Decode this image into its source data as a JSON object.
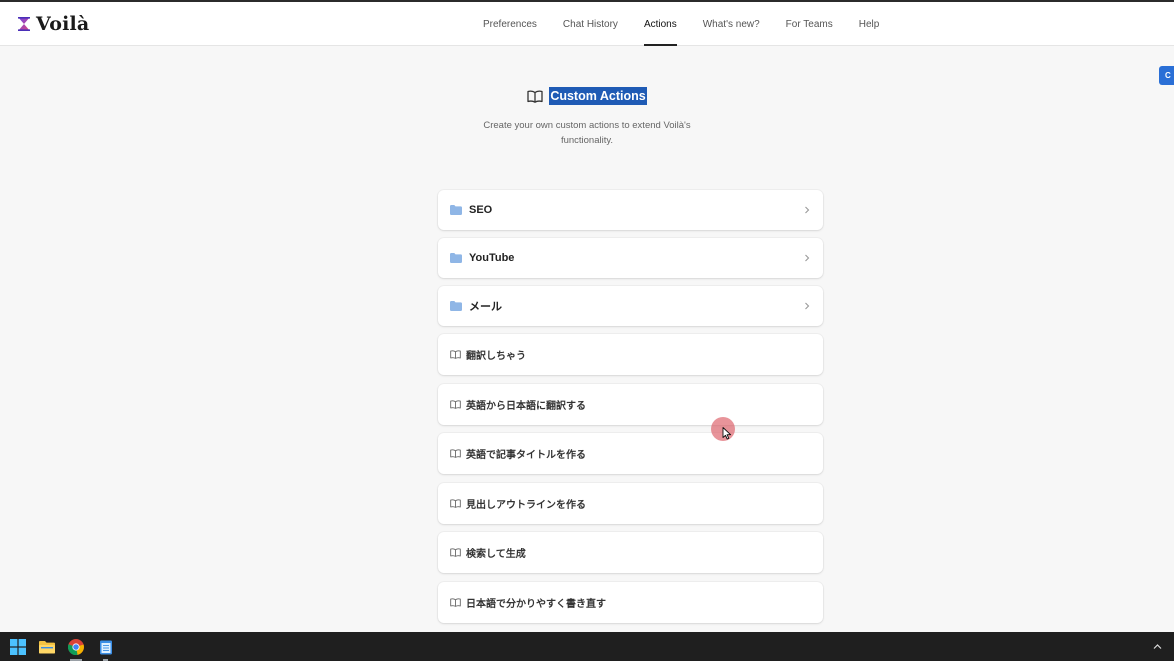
{
  "app": {
    "brand": "Voilà",
    "logo_icon": "hourglass-x-icon"
  },
  "nav": {
    "items": [
      {
        "label": "Preferences"
      },
      {
        "label": "Chat History"
      },
      {
        "label": "Actions",
        "active": true
      },
      {
        "label": "What's new?"
      },
      {
        "label": "For Teams"
      },
      {
        "label": "Help"
      }
    ]
  },
  "side_tab": {
    "label": "C"
  },
  "header": {
    "icon": "book-open-icon",
    "title": "Custom Actions",
    "subtitle": "Create your own custom actions to extend Voilà's functionality."
  },
  "folders": [
    {
      "label": "SEO",
      "icon": "folder-icon"
    },
    {
      "label": "YouTube",
      "icon": "folder-icon"
    },
    {
      "label": "メール",
      "icon": "folder-icon"
    }
  ],
  "actions": [
    {
      "label": "翻訳しちゃう",
      "icon": "book-open-icon"
    },
    {
      "label": "英語から日本語に翻訳する",
      "icon": "book-open-icon"
    },
    {
      "label": "英語で記事タイトルを作る",
      "icon": "book-open-icon"
    },
    {
      "label": "見出しアウトラインを作る",
      "icon": "book-open-icon"
    },
    {
      "label": "検索して生成",
      "icon": "book-open-icon"
    },
    {
      "label": "日本語で分かりやすく書き直す",
      "icon": "book-open-icon"
    }
  ],
  "taskbar": {
    "icons": [
      "windows-start-icon",
      "file-explorer-icon",
      "chrome-icon",
      "notepad-icon"
    ],
    "tray_icon": "chevron-up-icon"
  },
  "colors": {
    "accent": "#1f5bb5",
    "folder": "#8fb6e6",
    "side_tab": "#2a6fd6",
    "taskbar": "#1f1f1f"
  }
}
